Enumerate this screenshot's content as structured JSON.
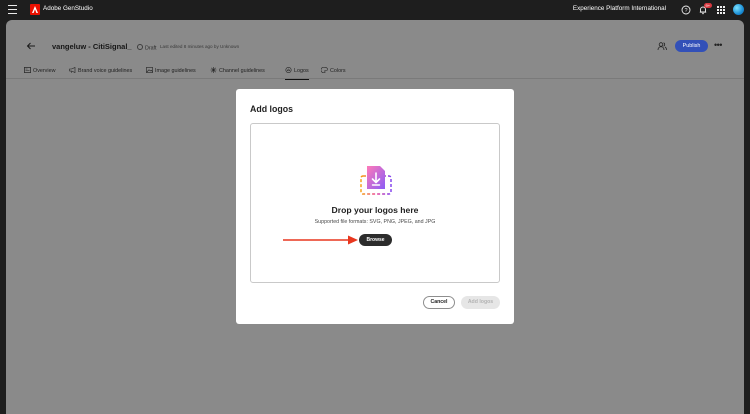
{
  "app": {
    "brand": "Adobe GenStudio",
    "org": "Experience Platform International",
    "notification_count": "9+"
  },
  "header": {
    "title": "vangeluw - CitiSignal_",
    "status": "Draft",
    "edited": "Last edited 8 minutes ago by Unknown",
    "publish_label": "Publish"
  },
  "tabs": [
    {
      "label": "Overview",
      "icon": "overview-icon"
    },
    {
      "label": "Brand voice guidelines",
      "icon": "megaphone-icon"
    },
    {
      "label": "Image guidelines",
      "icon": "image-icon"
    },
    {
      "label": "Channel guidelines",
      "icon": "channel-icon"
    },
    {
      "label": "Logos",
      "icon": "logo-icon",
      "active": true
    },
    {
      "label": "Colors",
      "icon": "palette-icon"
    }
  ],
  "modal": {
    "title": "Add logos",
    "drop_title": "Drop your logos here",
    "drop_subtitle": "Supported file formats: SVG, PNG, JPEG, and JPG",
    "browse_label": "Browse",
    "cancel_label": "Cancel",
    "add_label": "Add logos"
  },
  "colors": {
    "accent": "#3250b8",
    "annotation_arrow": "#e8371f",
    "adobe_red": "#eb1000"
  }
}
